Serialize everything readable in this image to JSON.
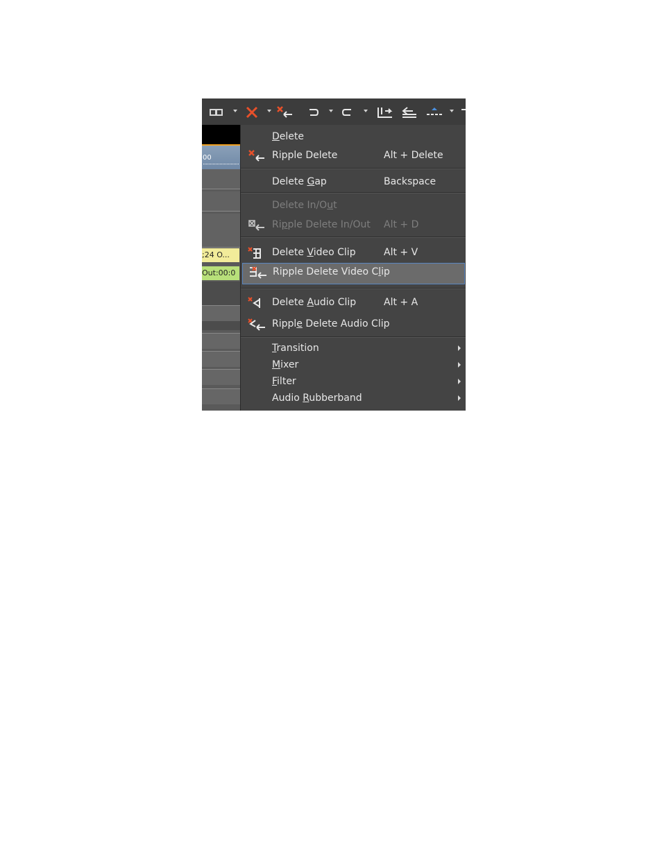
{
  "timeline": {
    "ruler_text": "00",
    "clip_in_text": ";24 O...",
    "clip_out_text": "Out:00:0"
  },
  "menu": {
    "items": [
      {
        "icon": "none",
        "pre": "",
        "key": "D",
        "post": "elete",
        "shortcut": "",
        "disabled": false,
        "highlighted": false
      },
      {
        "icon": "ripple-delete-icon",
        "pre": "Ripple Delete",
        "key": "",
        "post": "",
        "shortcut": "Alt + Delete",
        "disabled": false,
        "highlighted": false
      },
      {
        "icon": "none",
        "pre": "Delete ",
        "key": "G",
        "post": "ap",
        "shortcut": "Backspace",
        "disabled": false,
        "highlighted": false
      },
      {
        "icon": "none",
        "pre": "Delete In/O",
        "key": "u",
        "post": "t",
        "shortcut": "",
        "disabled": true,
        "highlighted": false
      },
      {
        "icon": "ripple-delete-in-out-icon",
        "pre": "Ri",
        "key": "p",
        "post": "ple Delete In/Out",
        "shortcut": "Alt + D",
        "disabled": true,
        "highlighted": false
      },
      {
        "icon": "delete-video-clip-icon",
        "pre": "Delete ",
        "key": "V",
        "post": "ideo Clip",
        "shortcut": "Alt + V",
        "disabled": false,
        "highlighted": false
      },
      {
        "icon": "ripple-delete-video-clip-icon",
        "pre": "Ripple Delete Video C",
        "key": "l",
        "post": "ip",
        "shortcut": "",
        "disabled": false,
        "highlighted": true
      },
      {
        "icon": "delete-audio-clip-icon",
        "pre": "Delete ",
        "key": "A",
        "post": "udio Clip",
        "shortcut": "Alt + A",
        "disabled": false,
        "highlighted": false
      },
      {
        "icon": "ripple-delete-audio-clip-icon",
        "pre": "Rippl",
        "key": "e",
        "post": " Delete Audio Clip",
        "shortcut": "",
        "disabled": false,
        "highlighted": false
      },
      {
        "icon": "none",
        "pre": "",
        "key": "T",
        "post": "ransition",
        "shortcut": "",
        "submenu": true,
        "disabled": false,
        "highlighted": false
      },
      {
        "icon": "none",
        "pre": "",
        "key": "M",
        "post": "ixer",
        "shortcut": "",
        "submenu": true,
        "disabled": false,
        "highlighted": false
      },
      {
        "icon": "none",
        "pre": "",
        "key": "F",
        "post": "ilter",
        "shortcut": "",
        "submenu": true,
        "disabled": false,
        "highlighted": false
      },
      {
        "icon": "none",
        "pre": "Audio ",
        "key": "R",
        "post": "ubberband",
        "shortcut": "",
        "submenu": true,
        "disabled": false,
        "highlighted": false
      }
    ]
  },
  "colors": {
    "delete_red": "#e8502a",
    "menu_bg": "#444444",
    "highlight_bg": "#6b6b6b",
    "highlight_border": "#5a86c0",
    "clip_in": "#f2ec9a",
    "clip_out": "#b8e07a"
  }
}
